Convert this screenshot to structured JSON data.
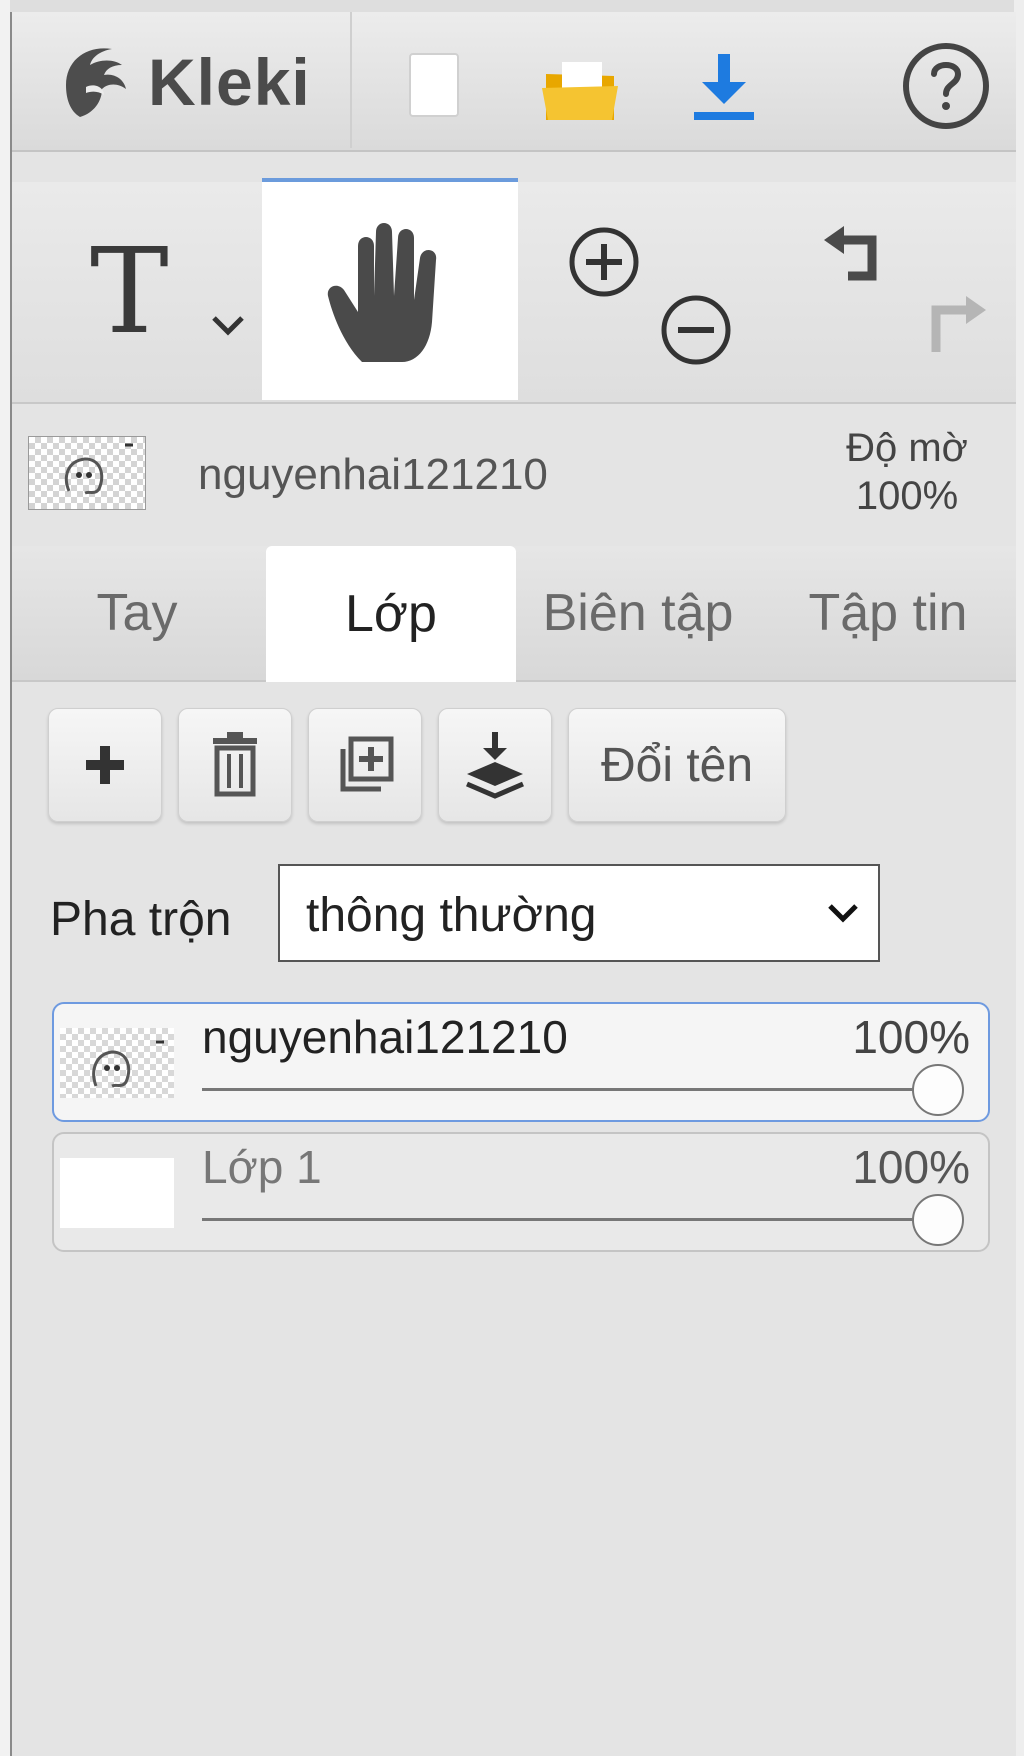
{
  "app": {
    "title": "Kleki"
  },
  "topbar": {
    "new_icon": "blank-page-icon",
    "open_icon": "folder-icon",
    "save_icon": "download-icon",
    "help_icon": "help-circle-icon"
  },
  "toolbar": {
    "text_glyph": "T",
    "tools": [
      "text-tool",
      "hand-tool",
      "zoom-in",
      "zoom-out",
      "undo",
      "redo"
    ]
  },
  "current_layer": {
    "name": "nguyenhai121210",
    "opacity_label": "Độ mờ",
    "opacity_value": "100%"
  },
  "tabs": [
    {
      "label": "Tay",
      "active": false
    },
    {
      "label": "Lớp",
      "active": true
    },
    {
      "label": "Biên tập",
      "active": false
    },
    {
      "label": "Tập tin",
      "active": false
    }
  ],
  "layer_panel": {
    "rename_label": "Đổi tên",
    "blend_label": "Pha trộn",
    "blend_value": "thông thường",
    "layers": [
      {
        "name": "nguyenhai121210",
        "opacity": "100%",
        "opacity_value": 1.0,
        "selected": true
      },
      {
        "name": "Lớp 1",
        "opacity": "100%",
        "opacity_value": 1.0,
        "selected": false
      }
    ]
  },
  "colors": {
    "accent": "#6b9bdc",
    "download_blue": "#1e7be0",
    "folder_yellow": "#f5c431"
  }
}
